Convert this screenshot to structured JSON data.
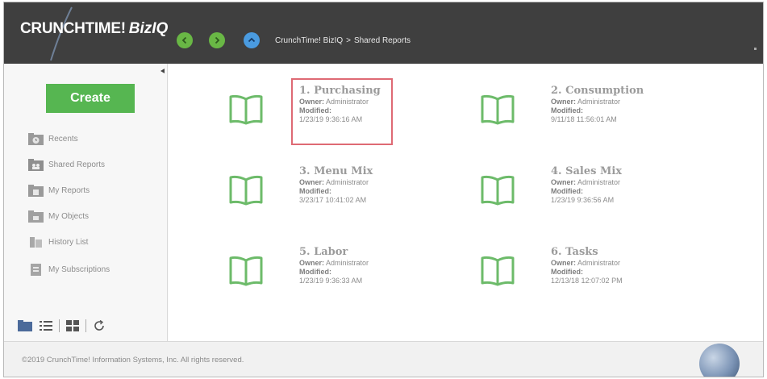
{
  "header": {
    "logo_main": "CRUNCHTIME",
    "logo_mark": "!",
    "logo_product": "BizIQ",
    "breadcrumb": [
      "CrunchTime! BizIQ",
      "Shared Reports"
    ],
    "breadcrumb_sep": ">"
  },
  "sidebar": {
    "create_label": "Create",
    "items": [
      {
        "label": "Recents",
        "icon": "clock-folder-icon"
      },
      {
        "label": "Shared Reports",
        "icon": "shared-folder-icon"
      },
      {
        "label": "My Reports",
        "icon": "report-folder-icon"
      },
      {
        "label": "My Objects",
        "icon": "objects-folder-icon"
      },
      {
        "label": "History List",
        "icon": "history-icon"
      },
      {
        "label": "My Subscriptions",
        "icon": "subscriptions-icon"
      }
    ]
  },
  "reports": [
    {
      "title": "1. Purchasing",
      "owner_label": "Owner:",
      "owner": "Administrator",
      "modified_label": "Modified:",
      "modified": "1/23/19 9:36:16 AM"
    },
    {
      "title": "2. Consumption",
      "owner_label": "Owner:",
      "owner": "Administrator",
      "modified_label": "Modified:",
      "modified": "9/11/18 11:56:01 AM"
    },
    {
      "title": "3. Menu Mix",
      "owner_label": "Owner:",
      "owner": "Administrator",
      "modified_label": "Modified:",
      "modified": "3/23/17 10:41:02 AM"
    },
    {
      "title": "4. Sales Mix",
      "owner_label": "Owner:",
      "owner": "Administrator",
      "modified_label": "Modified:",
      "modified": "1/23/19 9:36:56 AM"
    },
    {
      "title": "5. Labor",
      "owner_label": "Owner:",
      "owner": "Administrator",
      "modified_label": "Modified:",
      "modified": "1/23/19 9:36:33 AM"
    },
    {
      "title": "6. Tasks",
      "owner_label": "Owner:",
      "owner": "Administrator",
      "modified_label": "Modified:",
      "modified": "12/13/18 12:07:02 PM"
    }
  ],
  "footer": {
    "copyright": "©2019 CrunchTime! Information Systems, Inc. All rights reserved."
  },
  "colors": {
    "header_bg": "#3f3f3f",
    "create_green": "#56b651",
    "book_green": "#6dbb6a",
    "highlight_red": "#de6a74"
  }
}
